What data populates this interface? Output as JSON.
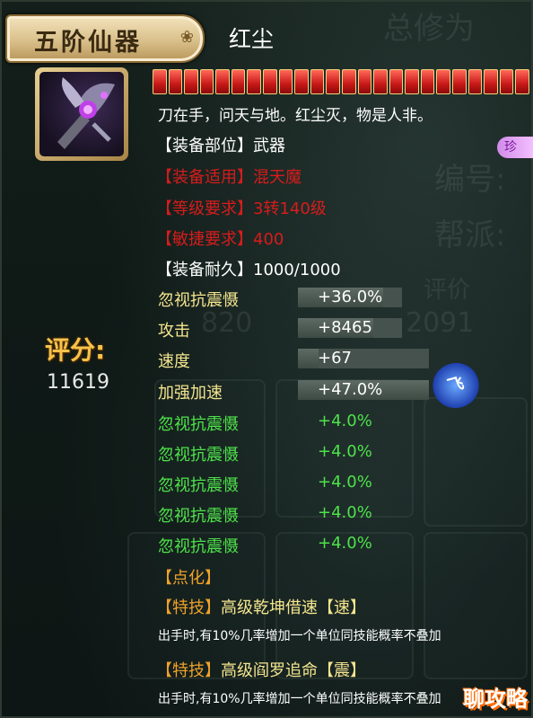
{
  "header": {
    "title_plate": "五阶仙器",
    "item_name": "红尘"
  },
  "description": "刀在手，问天与地。红尘灭，物是人非。",
  "durability_segments": 24,
  "attributes": [
    {
      "text": "【装备部位】武器",
      "style": "normal"
    },
    {
      "text": "【装备适用】混天魔",
      "style": "red"
    },
    {
      "text": "【等级要求】3转140级",
      "style": "red"
    },
    {
      "text": "【敏捷要求】400",
      "style": "red"
    },
    {
      "text": "【装备耐久】1000/1000",
      "style": "normal"
    }
  ],
  "score": {
    "label": "评分:",
    "value": "11619"
  },
  "main_stats": [
    {
      "name": "忽视抗震慑",
      "value": "+36.0%",
      "fill": 0.82
    },
    {
      "name": "攻击",
      "value": "+8465",
      "fill": 0.72
    },
    {
      "name": "速度",
      "value": "+67",
      "fill": 0.16
    },
    {
      "name": "加强加速",
      "value": "+47.0%",
      "fill": 1.0
    }
  ],
  "bonus_stats": [
    {
      "name": "忽视抗震慑",
      "value": "+4.0%"
    },
    {
      "name": "忽视抗震慑",
      "value": "+4.0%"
    },
    {
      "name": "忽视抗震慑",
      "value": "+4.0%"
    },
    {
      "name": "忽视抗震慑",
      "value": "+4.0%"
    },
    {
      "name": "忽视抗震慑",
      "value": "+4.0%"
    }
  ],
  "dianhua": {
    "label": "【点化】"
  },
  "skills": [
    {
      "prefix": "【特技】",
      "name": "高级乾坤借速【速】",
      "note": "出手时,有10%几率增加一个单位同技能概率不叠加"
    },
    {
      "prefix": "【特技】",
      "name": "高级阎罗追命【震】",
      "note": "出手时,有10%几率增加一个单位同技能概率不叠加"
    }
  ],
  "background_text": [
    "总修为",
    "编号:",
    "帮派:",
    "评价",
    "820",
    "2091"
  ],
  "side_badges": {
    "fly": "飞",
    "pink": "珍"
  },
  "watermark": "聊攻略",
  "colors": {
    "title_text": "#3a2a12",
    "red_requirement": "#d61c1c",
    "main_stat": "#f4e58e",
    "green_stat": "#4ee24a",
    "section_orange": "#f0a22a",
    "score_gold": "#f5c34a"
  }
}
